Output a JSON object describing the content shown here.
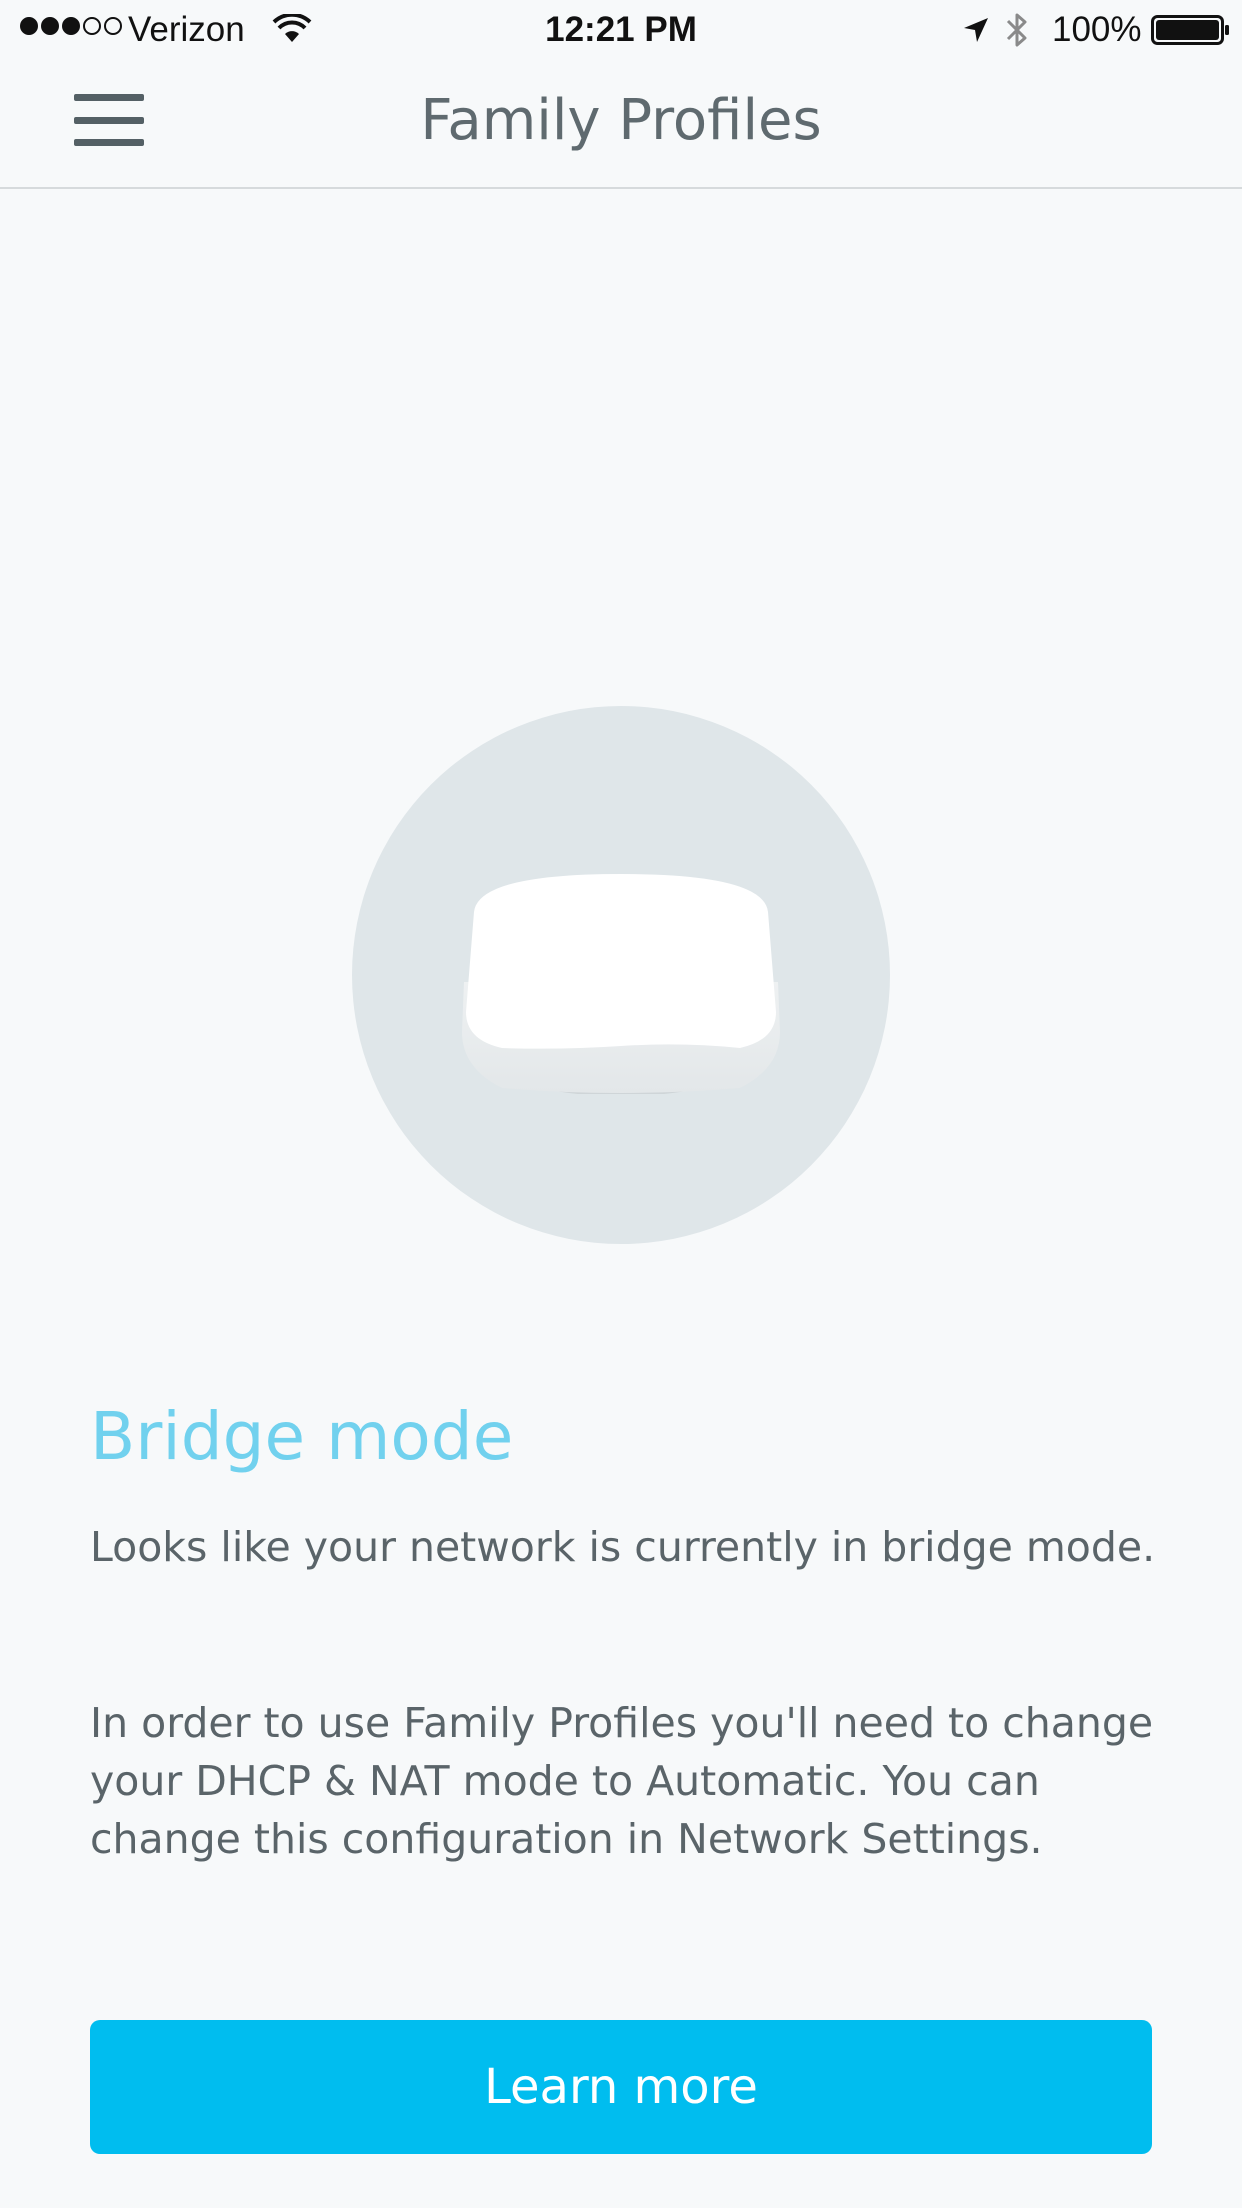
{
  "status_bar": {
    "carrier": "Verizon",
    "signal_bars_filled": 3,
    "signal_bars_total": 5,
    "time": "12:21 PM",
    "battery_percent": "100%",
    "icons": [
      "wifi-icon",
      "location-arrow-icon",
      "bluetooth-icon",
      "battery-icon"
    ]
  },
  "nav": {
    "title": "Family Profiles",
    "menu_icon": "hamburger-menu-icon"
  },
  "illustration": {
    "icon": "router-device-icon"
  },
  "content": {
    "heading": "Bridge mode",
    "paragraph1": "Looks like your network is currently in bridge mode.",
    "paragraph2": "In order to use Family Profiles you'll need to change your DHCP & NAT mode to Automatic. You can change this configuration in Network Settings."
  },
  "actions": {
    "learn_more_label": "Learn more"
  },
  "colors": {
    "accent": "#00bdef",
    "heading": "#71d1ee",
    "background": "#f7f9fa",
    "circle": "#dfe6e9"
  }
}
